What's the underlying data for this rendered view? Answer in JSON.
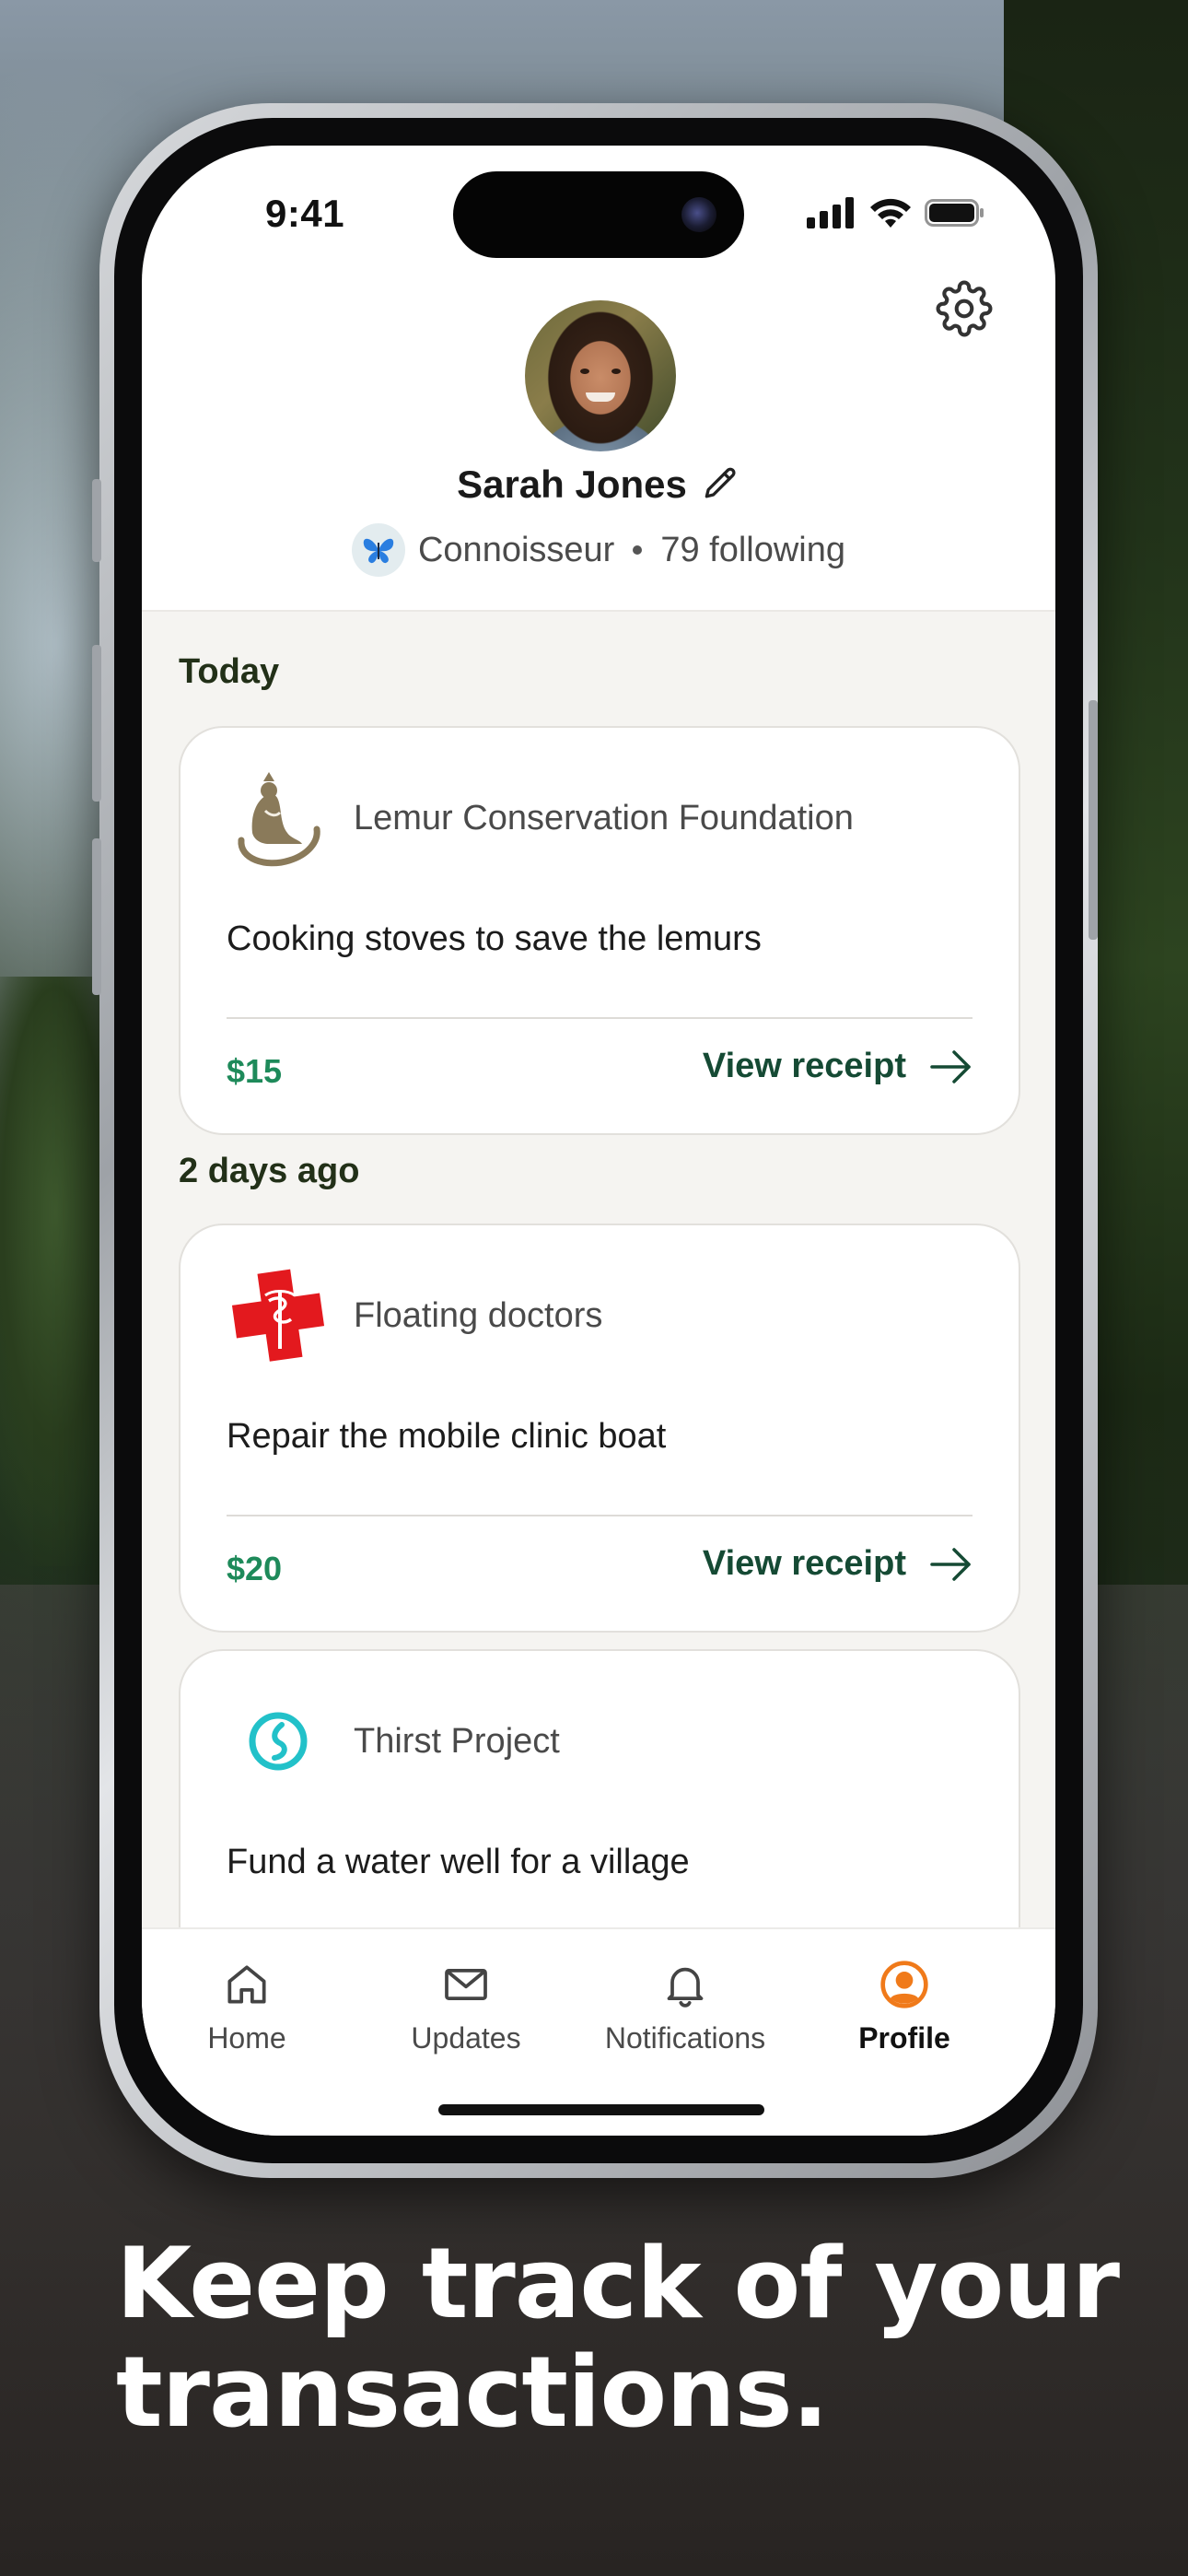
{
  "status_bar": {
    "time": "9:41"
  },
  "profile": {
    "name": "Sarah Jones",
    "badge_label": "Connoisseur",
    "following": "79 following"
  },
  "feed": {
    "sections": [
      {
        "label": "Today",
        "cards": [
          {
            "org": "Lemur Conservation Foundation",
            "title": "Cooking stoves to save the lemurs",
            "amount": "$15",
            "link": "View receipt"
          }
        ]
      },
      {
        "label": "2 days ago",
        "cards": [
          {
            "org": "Floating doctors",
            "title": "Repair the mobile clinic boat",
            "amount": "$20",
            "link": "View receipt"
          },
          {
            "org": "Thirst Project",
            "title": "Fund a water well for a village"
          }
        ]
      }
    ]
  },
  "tab_bar": {
    "tabs": [
      {
        "label": "Home",
        "icon": "home-icon"
      },
      {
        "label": "Updates",
        "icon": "mail-icon"
      },
      {
        "label": "Notifications",
        "icon": "bell-icon"
      },
      {
        "label": "Profile",
        "icon": "profile-icon",
        "active": true
      }
    ]
  },
  "tagline": {
    "line1": "Keep track of your",
    "line2": "transactions."
  },
  "colors": {
    "accent_green": "#1e8a5a",
    "link_green": "#154a34",
    "profile_orange": "#f07a1a",
    "thirst_teal": "#22c1c9",
    "red_cross": "#e3191e"
  }
}
